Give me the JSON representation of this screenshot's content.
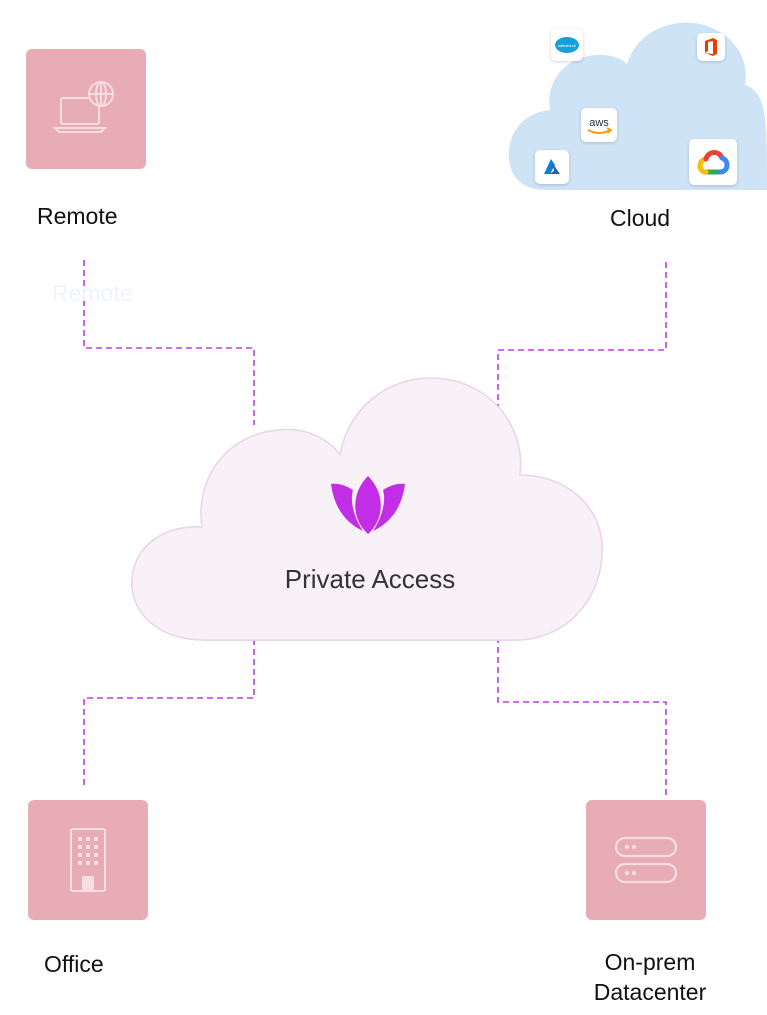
{
  "nodes": {
    "remote": {
      "label": "Remote",
      "ghost_label": "Remote",
      "icon": "laptop-globe-icon"
    },
    "cloud": {
      "label": "Cloud",
      "icon": "cloud-icon"
    },
    "office": {
      "label": "Office",
      "icon": "office-building-icon"
    },
    "datacenter": {
      "label_line1": "On-prem",
      "label_line2": "Datacenter",
      "icon": "server-stack-icon"
    }
  },
  "center": {
    "title": "Private Access",
    "logo": "lotus-logo-icon"
  },
  "cloud_providers": [
    {
      "name": "salesforce",
      "text": "salesforce"
    },
    {
      "name": "office365",
      "text": ""
    },
    {
      "name": "aws",
      "text": "aws"
    },
    {
      "name": "azure",
      "text": ""
    },
    {
      "name": "google-cloud",
      "text": ""
    }
  ],
  "colors": {
    "tile": "#e8adb4",
    "connector": "#c03ee6",
    "logo": "#c22ee6",
    "cloud_bg": "#cfe3f7",
    "center_cloud": "#f8f1f8"
  }
}
